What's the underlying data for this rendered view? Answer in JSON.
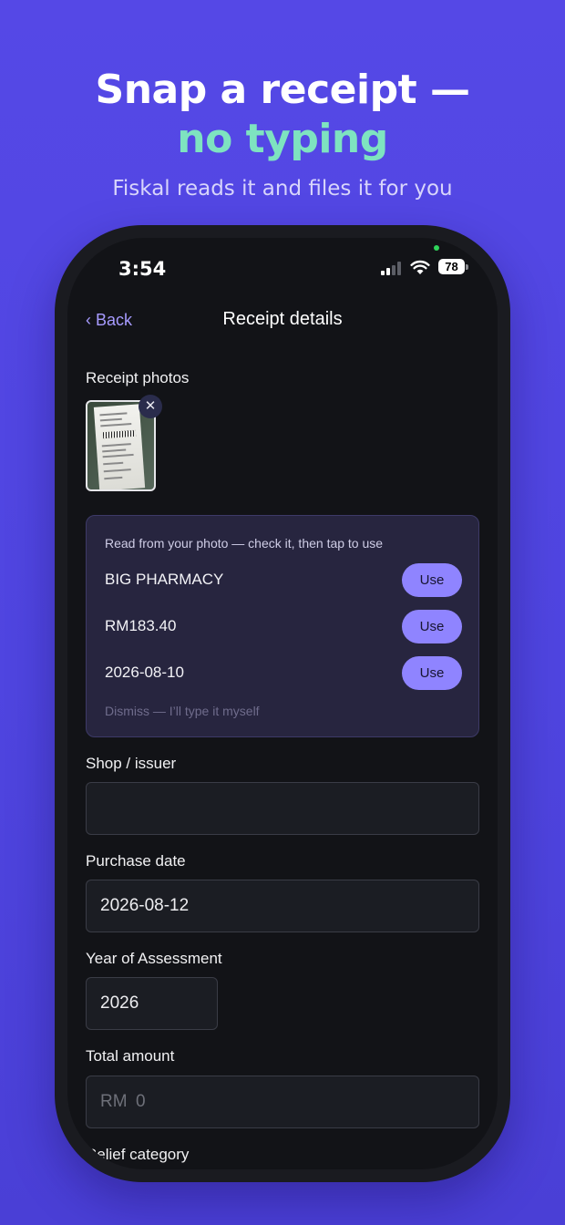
{
  "promo": {
    "headline_line1": "Snap a receipt —",
    "headline_line2": "no typing",
    "subline": "Fiskal reads it and files it for you",
    "accent_color": "#7ee3c0",
    "background_color": "#5548e6"
  },
  "status_bar": {
    "time": "3:54",
    "battery": "78"
  },
  "nav": {
    "back_label": "‹ Back",
    "title": "Receipt details"
  },
  "photos": {
    "label": "Receipt photos",
    "thumbnail_icon": "receipt-photo",
    "remove_icon": "close-icon",
    "remove_glyph": "✕"
  },
  "ocr_suggestions": {
    "hint": "Read from your photo — check it, then tap to use",
    "items": [
      {
        "value": "BIG PHARMACY",
        "action": "Use"
      },
      {
        "value": "RM183.40",
        "action": "Use"
      },
      {
        "value": "2026-08-10",
        "action": "Use"
      }
    ],
    "dismiss": "Dismiss — I’ll type it myself",
    "button_color": "#8f84ff"
  },
  "form": {
    "shop": {
      "label": "Shop / issuer",
      "value": ""
    },
    "purchase_date": {
      "label": "Purchase date",
      "value": "2026-08-12"
    },
    "year_of_assessment": {
      "label": "Year of Assessment",
      "value": "2026"
    },
    "total_amount": {
      "label": "Total amount",
      "prefix": "RM",
      "placeholder": "0"
    },
    "relief_category": {
      "label": "Relief category"
    }
  }
}
